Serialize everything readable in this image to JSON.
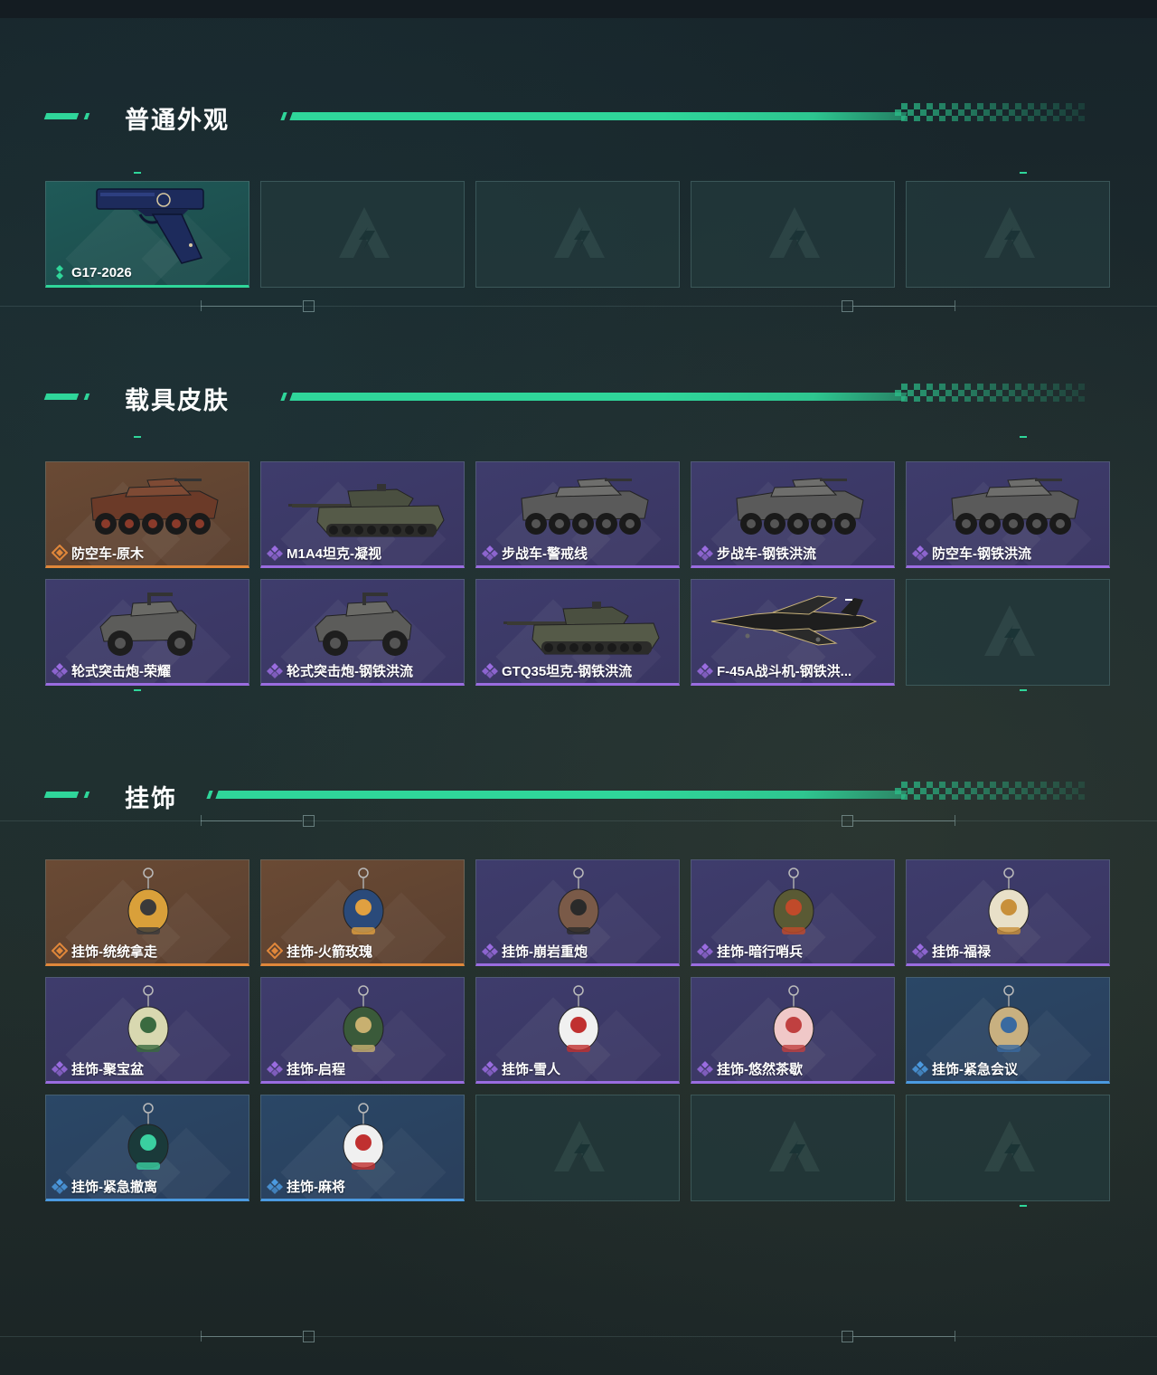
{
  "sections": [
    {
      "title": "普通外观",
      "items": [
        {
          "name": "G17-2026",
          "rarity": "green",
          "icon": "pistol-icon"
        },
        {
          "empty": true
        },
        {
          "empty": true
        },
        {
          "empty": true
        },
        {
          "empty": true
        }
      ]
    },
    {
      "title": "载具皮肤",
      "items": [
        {
          "name": "防空车-原木",
          "rarity": "orange",
          "icon": "armored-vehicle-icon"
        },
        {
          "name": "M1A4坦克-凝视",
          "rarity": "purple",
          "icon": "tank-icon"
        },
        {
          "name": "步战车-警戒线",
          "rarity": "purple",
          "icon": "armored-vehicle-icon"
        },
        {
          "name": "步战车-钢铁洪流",
          "rarity": "purple",
          "icon": "armored-vehicle-icon"
        },
        {
          "name": "防空车-钢铁洪流",
          "rarity": "purple",
          "icon": "armored-vehicle-icon"
        },
        {
          "name": "轮式突击炮-荣耀",
          "rarity": "purple",
          "icon": "buggy-icon"
        },
        {
          "name": "轮式突击炮-钢铁洪流",
          "rarity": "purple",
          "icon": "buggy-icon"
        },
        {
          "name": "GTQ35坦克-钢铁洪流",
          "rarity": "purple",
          "icon": "tank-icon"
        },
        {
          "name": "F-45A战斗机-钢铁洪...",
          "rarity": "purple",
          "icon": "jet-icon"
        },
        {
          "empty": true
        }
      ]
    },
    {
      "title": "挂饰",
      "items": [
        {
          "name": "挂饰-统统拿走",
          "rarity": "orange",
          "icon": "charm-icon"
        },
        {
          "name": "挂饰-火箭玫瑰",
          "rarity": "orange",
          "icon": "charm-icon"
        },
        {
          "name": "挂饰-崩岩重炮",
          "rarity": "purple",
          "icon": "charm-icon"
        },
        {
          "name": "挂饰-暗行哨兵",
          "rarity": "purple",
          "icon": "charm-icon"
        },
        {
          "name": "挂饰-福禄",
          "rarity": "purple",
          "icon": "charm-icon"
        },
        {
          "name": "挂饰-聚宝盆",
          "rarity": "purple",
          "icon": "charm-icon"
        },
        {
          "name": "挂饰-启程",
          "rarity": "purple",
          "icon": "charm-icon"
        },
        {
          "name": "挂饰-雪人",
          "rarity": "purple",
          "icon": "charm-icon"
        },
        {
          "name": "挂饰-悠然茶歇",
          "rarity": "purple",
          "icon": "charm-icon"
        },
        {
          "name": "挂饰-紧急会议",
          "rarity": "blue",
          "icon": "charm-icon"
        },
        {
          "name": "挂饰-紧急撤离",
          "rarity": "blue",
          "icon": "charm-icon"
        },
        {
          "name": "挂饰-麻将",
          "rarity": "blue",
          "icon": "charm-icon"
        },
        {
          "empty": true
        },
        {
          "empty": true
        },
        {
          "empty": true
        }
      ]
    }
  ],
  "colors": {
    "accent": "#2fd69a",
    "green": "#2fd69a",
    "orange": "#e0873a",
    "purple": "#9a6ce0",
    "blue": "#4b9ae0"
  }
}
